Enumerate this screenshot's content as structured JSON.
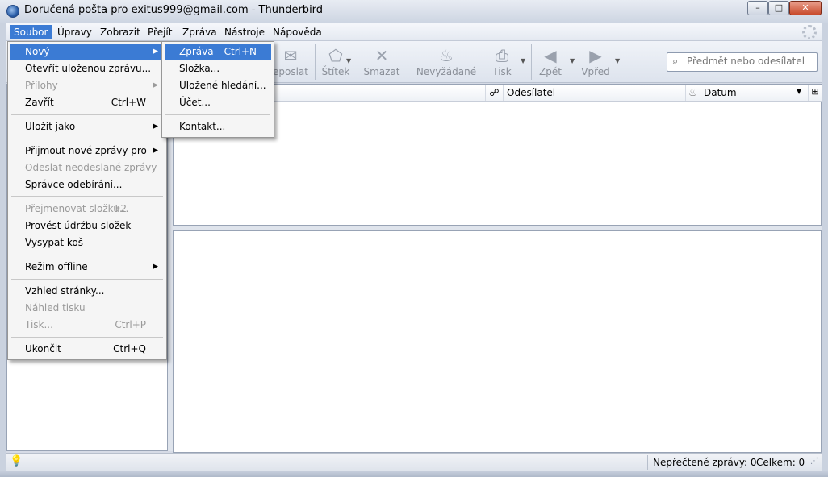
{
  "window": {
    "title": "Doručená pošta pro exitus999@gmail.com - Thunderbird",
    "min_glyph": "–",
    "max_glyph": "□",
    "close_glyph": "✕"
  },
  "menubar": {
    "items": [
      "Soubor",
      "Úpravy",
      "Zobrazit",
      "Přejít",
      "Zpráva",
      "Nástroje",
      "Nápověda"
    ]
  },
  "toolbar": {
    "buttons": [
      {
        "label": "eposlat",
        "icon": "forward-icon"
      },
      {
        "label": "Štítek",
        "icon": "tag-icon"
      },
      {
        "label": "Smazat",
        "icon": "delete-icon"
      },
      {
        "label": "Nevyžádané",
        "icon": "junk-icon"
      },
      {
        "label": "Tisk",
        "icon": "print-icon"
      },
      {
        "label": "Zpět",
        "icon": "back-icon"
      },
      {
        "label": "Vpřed",
        "icon": "forward-arrow-icon"
      }
    ],
    "search_placeholder": "Předmět nebo odesílatel"
  },
  "columns": {
    "sender": "Odesílatel",
    "date": "Datum"
  },
  "file_menu": {
    "items": [
      {
        "label": "Nový",
        "shortcut": "",
        "submenu": true,
        "disabled": false,
        "highlighted": true
      },
      {
        "label": "Otevřít uloženou zprávu...",
        "shortcut": "",
        "submenu": false,
        "disabled": false
      },
      {
        "label": "Přílohy",
        "shortcut": "",
        "submenu": true,
        "disabled": true
      },
      {
        "label": "Zavřít",
        "shortcut": "Ctrl+W",
        "submenu": false,
        "disabled": false
      },
      {
        "label": "Uložit jako",
        "shortcut": "",
        "submenu": true,
        "disabled": false
      },
      {
        "label": "Přijmout nové zprávy pro",
        "shortcut": "",
        "submenu": true,
        "disabled": false
      },
      {
        "label": "Odeslat neodeslané zprávy",
        "shortcut": "",
        "submenu": false,
        "disabled": true
      },
      {
        "label": "Správce odebírání...",
        "shortcut": "",
        "submenu": false,
        "disabled": false
      },
      {
        "label": "Přejmenovat složku...",
        "shortcut": "F2",
        "submenu": false,
        "disabled": true
      },
      {
        "label": "Provést údržbu složek",
        "shortcut": "",
        "submenu": false,
        "disabled": false
      },
      {
        "label": "Vysypat koš",
        "shortcut": "",
        "submenu": false,
        "disabled": false
      },
      {
        "label": "Režim offline",
        "shortcut": "",
        "submenu": true,
        "disabled": false
      },
      {
        "label": "Vzhled stránky...",
        "shortcut": "",
        "submenu": false,
        "disabled": false
      },
      {
        "label": "Náhled tisku",
        "shortcut": "",
        "submenu": false,
        "disabled": true
      },
      {
        "label": "Tisk...",
        "shortcut": "Ctrl+P",
        "submenu": false,
        "disabled": true
      },
      {
        "label": "Ukončit",
        "shortcut": "Ctrl+Q",
        "submenu": false,
        "disabled": false
      }
    ]
  },
  "new_submenu": {
    "items": [
      {
        "label": "Zpráva",
        "shortcut": "Ctrl+N",
        "highlighted": true
      },
      {
        "label": "Složka...",
        "shortcut": ""
      },
      {
        "label": "Uložené hledání...",
        "shortcut": ""
      },
      {
        "label": "Účet...",
        "shortcut": ""
      },
      {
        "label": "Kontakt...",
        "shortcut": ""
      }
    ]
  },
  "status": {
    "unread": "Nepřečtené zprávy: 0",
    "total": "Celkem: 0"
  }
}
